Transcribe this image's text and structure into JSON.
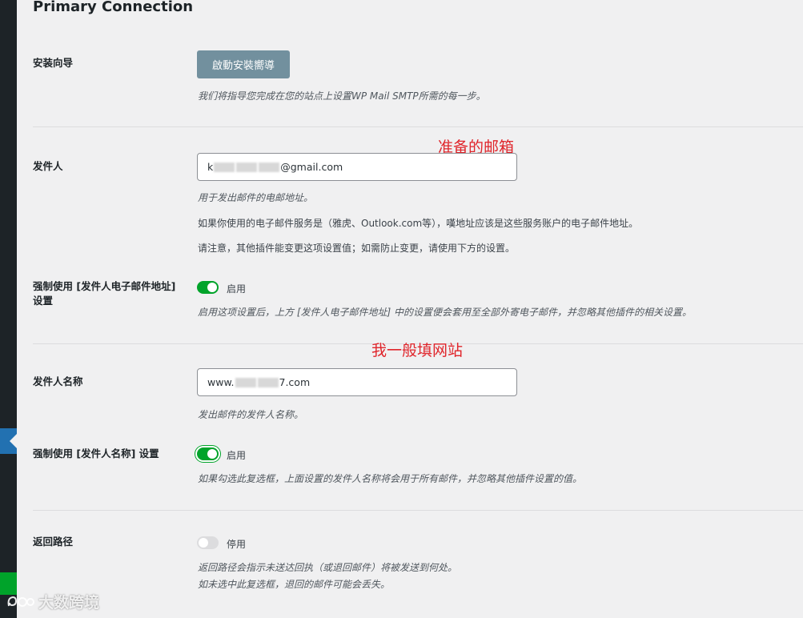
{
  "section": {
    "title": "Primary Connection"
  },
  "setup_wizard": {
    "label": "安装向导",
    "button_label": "啟動安裝嚮導",
    "description": "我们将指导您完成在您的站点上设置WP Mail SMTP所需的每一步。"
  },
  "from_email": {
    "label": "发件人",
    "value_prefix": "k",
    "value_suffix": "@gmail.com",
    "desc1": "用于发出邮件的电邮地址。",
    "desc2": "如果你使用的电子邮件服务是（雅虎、Outlook.com等），嘆地址应该是这些服务账户的电子邮件地址。",
    "desc3": "请注意，其他插件能变更这项设置值；如需防止变更，请使用下方的设置。"
  },
  "force_from_email": {
    "label": "强制使用 [发件人电子邮件地址] 设置",
    "toggle_label": "启用",
    "enabled": true,
    "description": "启用这项设置后，上方 [发件人电子邮件地址] 中的设置便会套用至全部外寄电子邮件，并忽略其他插件的相关设置。"
  },
  "from_name": {
    "label": "发件人名称",
    "value_prefix": "www.",
    "value_suffix": "7.com",
    "description": "发出邮件的发件人名称。"
  },
  "force_from_name": {
    "label": "强制使用 [发件人名称] 设置",
    "toggle_label": "启用",
    "enabled": true,
    "description": "如果勾选此复选框，上面设置的发件人名称将会用于所有邮件，并忽略其他插件设置的值。"
  },
  "return_path": {
    "label": "返回路径",
    "toggle_label": "停用",
    "enabled": false,
    "desc1": "返回路径会指示未送达回执（或退回邮件）将被发送到何处。",
    "desc2": "如未选中此复选框，退回的邮件可能会丢失。"
  },
  "annotations": {
    "email_note": "准备的邮箱",
    "name_note": "我一般填网站"
  },
  "watermark": {
    "text": "大数跨境"
  },
  "colors": {
    "accent_green": "#00a32a",
    "annotation_red": "#e0252b",
    "sidebar": "#1d2327",
    "button": "#72909e"
  }
}
